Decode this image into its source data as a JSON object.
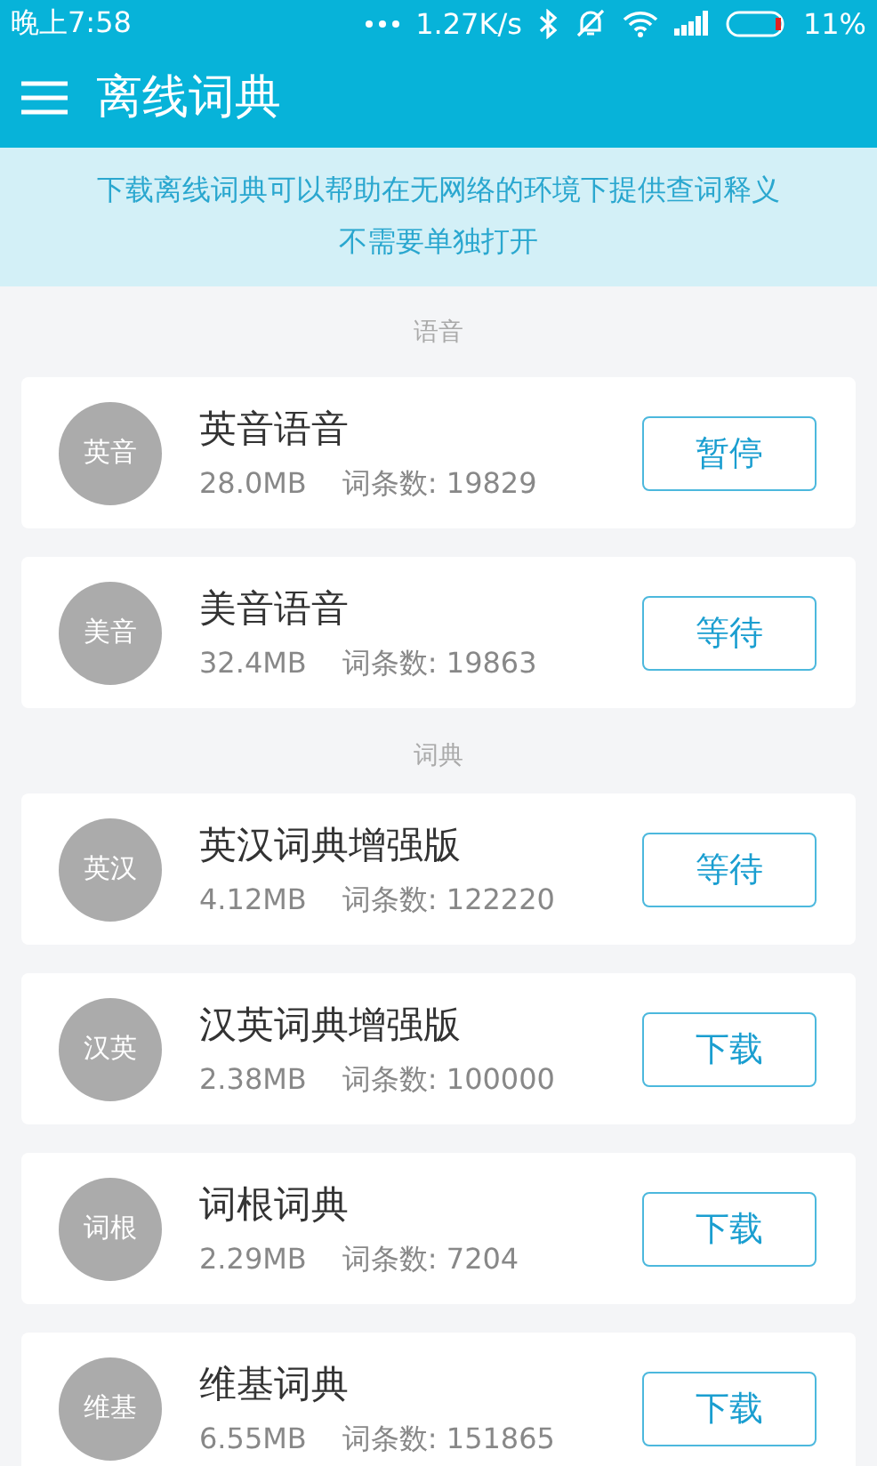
{
  "status_bar": {
    "time": "晚上7:58",
    "speed": "1.27K/s",
    "battery": "11%"
  },
  "app_bar": {
    "title": "离线词典"
  },
  "banner": {
    "lines": [
      "下载离线词典可以帮助在无网络的环境下提供查词释义",
      "不需要单独打开"
    ]
  },
  "sections": [
    {
      "title": "语音",
      "items": [
        {
          "badge": "英音",
          "name": "英音语音",
          "size": "28.0MB",
          "count": "词条数: 19829",
          "action": "暂停"
        },
        {
          "badge": "美音",
          "name": "美音语音",
          "size": "32.4MB",
          "count": "词条数: 19863",
          "action": "等待"
        }
      ]
    },
    {
      "title": "词典",
      "items": [
        {
          "badge": "英汉",
          "name": "英汉词典增强版",
          "size": "4.12MB",
          "count": "词条数: 122220",
          "action": "等待"
        },
        {
          "badge": "汉英",
          "name": "汉英词典增强版",
          "size": "2.38MB",
          "count": "词条数: 100000",
          "action": "下载"
        },
        {
          "badge": "词根",
          "name": "词根词典",
          "size": "2.29MB",
          "count": "词条数: 7204",
          "action": "下载"
        },
        {
          "badge": "维基",
          "name": "维基词典",
          "size": "6.55MB",
          "count": "词条数: 151865",
          "action": "下载"
        }
      ]
    }
  ]
}
